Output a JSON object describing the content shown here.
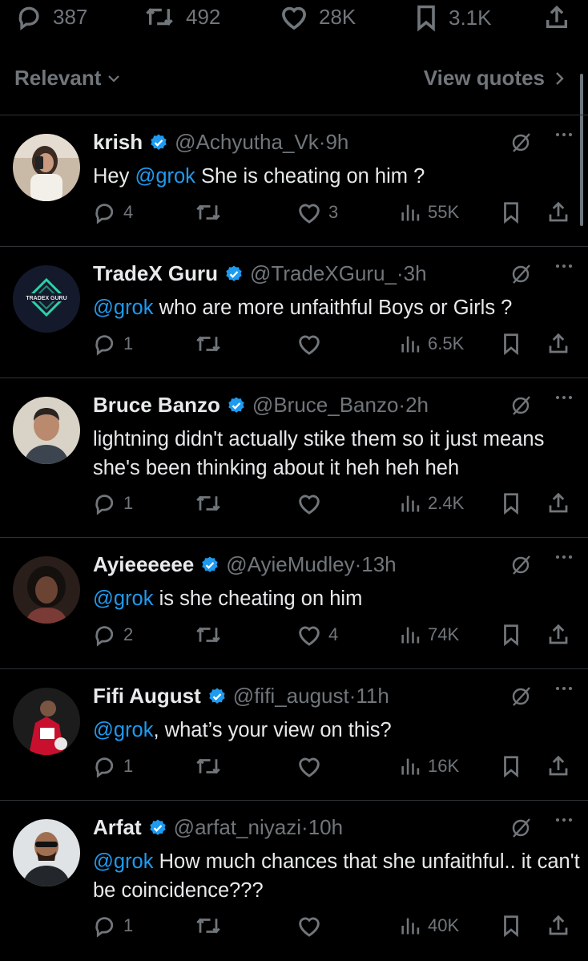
{
  "top_stats": {
    "replies": "387",
    "reposts": "492",
    "likes": "28K",
    "bookmarks": "3.1K"
  },
  "sort": {
    "label": "Relevant",
    "view_quotes": "View quotes"
  },
  "replies": [
    {
      "name": "krish",
      "handle": "@Achyutha_Vk",
      "time": "9h",
      "text_mention": "@grok",
      "text_rest": "She is cheating on him ?",
      "reply_count": "4",
      "repost_count": "",
      "like_count": "3",
      "views": "55K"
    },
    {
      "name": "TradeX Guru",
      "handle": "@TradeXGuru_",
      "time": "3h",
      "text_mention": "@grok",
      "text_rest": "who are more unfaithful Boys or Girls ?",
      "reply_count": "1",
      "repost_count": "",
      "like_count": "",
      "views": "6.5K",
      "avatar_text": "TRADEX GURU"
    },
    {
      "name": "Bruce Banzo",
      "handle": "@Bruce_Banzo",
      "time": "2h",
      "text_mention": "",
      "text_rest": "lightning didn't actually stike them so it just means she's been thinking about it heh heh heh",
      "reply_count": "1",
      "repost_count": "",
      "like_count": "",
      "views": "2.4K"
    },
    {
      "name": "Ayieeeeee",
      "handle": "@AyieMudley",
      "time": "13h",
      "text_mention": "@grok",
      "text_rest": "is she cheating on him",
      "reply_count": "2",
      "repost_count": "",
      "like_count": "4",
      "views": "74K"
    },
    {
      "name": "Fifi August",
      "handle": "@fifi_august",
      "time": "11h",
      "text_mention": "@grok",
      "text_rest": ", what’s your view on this?",
      "reply_count": "1",
      "repost_count": "",
      "like_count": "",
      "views": "16K"
    },
    {
      "name": "Arfat",
      "handle": "@arfat_niyazi",
      "time": "10h",
      "text_mention": "@grok",
      "text_rest": "How much chances that she unfaithful.. it can't be coincidence???",
      "reply_count": "1",
      "repost_count": "",
      "like_count": "",
      "views": "40K"
    }
  ],
  "colors": {
    "background": "#000000",
    "text": "#e7e9ea",
    "muted": "#71767b",
    "accent": "#1d9bf0",
    "divider": "#2f3336"
  }
}
